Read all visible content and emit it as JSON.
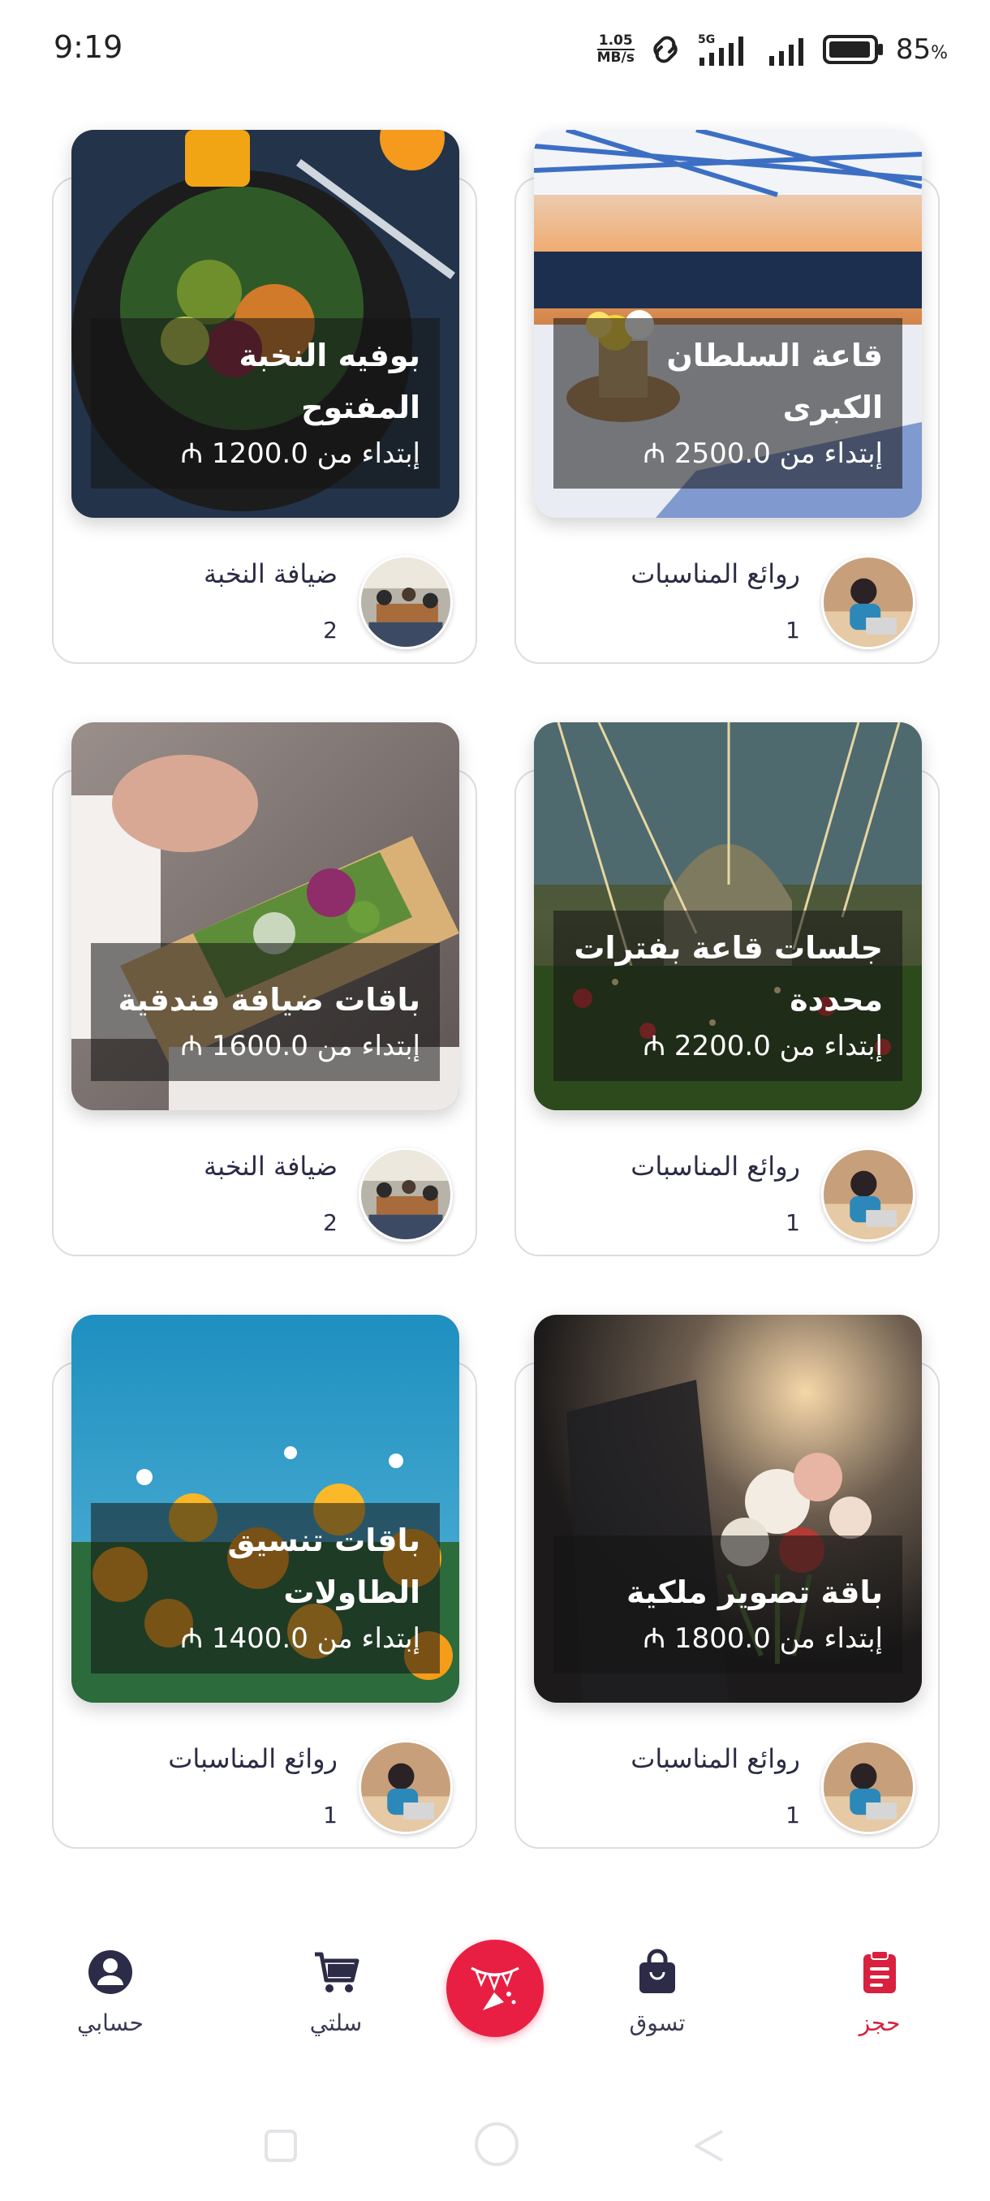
{
  "status_bar": {
    "time": "9:19",
    "speed_value": "1.05",
    "speed_unit": "MB/s",
    "network": "5G",
    "battery": "85",
    "battery_unit": "%"
  },
  "cards": [
    {
      "title": "قاعة السلطان الكبرى",
      "price": "إبتداء من 2500.0 ₼",
      "vendor": "روائع المناسبات",
      "count": "1",
      "image": "banquet-hall-photo",
      "avatar": "woman-at-desk-photo"
    },
    {
      "title": "بوفيه النخبة المفتوح",
      "price": "إبتداء من 1200.0 ₼",
      "vendor": "ضيافة النخبة",
      "count": "2",
      "image": "salad-plate-photo",
      "avatar": "office-meeting-photo"
    },
    {
      "title": "جلسات قاعة بفترات محددة",
      "price": "إبتداء من 2200.0 ₼",
      "vendor": "روائع المناسبات",
      "count": "1",
      "image": "decorated-hall-photo",
      "avatar": "woman-at-desk-photo"
    },
    {
      "title": "باقات ضيافة فندقية",
      "price": "إبتداء من 1600.0 ₼",
      "vendor": "ضيافة النخبة",
      "count": "2",
      "image": "pizza-slice-photo",
      "avatar": "office-meeting-photo"
    },
    {
      "title": "باقة تصوير ملكية",
      "price": "إبتداء من 1800.0 ₼",
      "vendor": "روائع المناسبات",
      "count": "1",
      "image": "wedding-bouquet-photo",
      "avatar": "woman-at-desk-photo"
    },
    {
      "title": "باقات تنسيق الطاولات",
      "price": "إبتداء من 1400.0 ₼",
      "vendor": "روائع المناسبات",
      "count": "1",
      "image": "yellow-flowers-photo",
      "avatar": "woman-at-desk-photo"
    }
  ],
  "bottom_nav": {
    "items": [
      {
        "label": "حجز",
        "icon": "clipboard-icon",
        "active": true
      },
      {
        "label": "تسوق",
        "icon": "shopping-bag-icon",
        "active": false
      },
      {
        "label": "",
        "icon": "party-flags-icon",
        "active": false
      },
      {
        "label": "سلتي",
        "icon": "cart-icon",
        "active": false
      },
      {
        "label": "حسابي",
        "icon": "account-icon",
        "active": false
      }
    ]
  },
  "colors": {
    "accent": "#e81f43",
    "text": "#2b2b45",
    "card_border": "#dcdde3"
  }
}
